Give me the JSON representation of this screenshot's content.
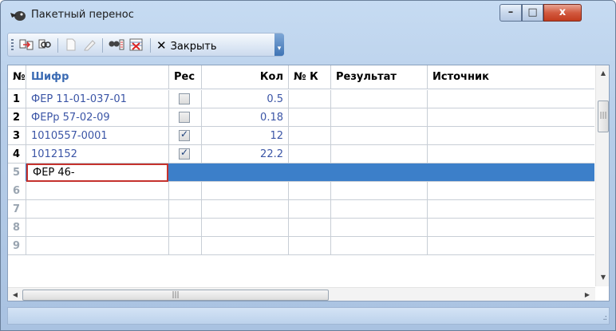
{
  "window": {
    "title": "Пакетный перенос",
    "controls": {
      "minimize": "–",
      "maximize": "□",
      "close": "x"
    }
  },
  "toolbar": {
    "buttons": [
      "import-icon",
      "find-icon",
      "new-doc-icon",
      "edit-icon",
      "search-replace-icon",
      "clear-icon"
    ],
    "close_label": "Закрыть",
    "close_glyph": "✕",
    "overflow_glyph": "▾"
  },
  "grid": {
    "columns": [
      "№",
      "Шифр",
      "Рес",
      "Кол",
      "№ К",
      "Результат",
      "Источник"
    ],
    "rows": [
      {
        "num": "1",
        "code": "ФЕР 11-01-037-01",
        "res": false,
        "qty": "0.5"
      },
      {
        "num": "2",
        "code": "ФЕРр 57-02-09",
        "res": false,
        "qty": "0.18"
      },
      {
        "num": "3",
        "code": "1010557-0001",
        "res": true,
        "qty": "12"
      },
      {
        "num": "4",
        "code": "1012152",
        "res": true,
        "qty": "22.2"
      }
    ],
    "edit_row": {
      "num": "5",
      "value": "ФЕР 46-"
    },
    "empty_rows": [
      "6",
      "7",
      "8",
      "9"
    ]
  },
  "scrollbars": {
    "up": "▲",
    "down": "▼",
    "left": "◀",
    "right": "▶",
    "grip": "|||"
  },
  "colors": {
    "selection": "#3c7fc9",
    "link_text": "#3b55a6",
    "edit_border": "#c5322d",
    "header_active": "#3a6ab3"
  }
}
